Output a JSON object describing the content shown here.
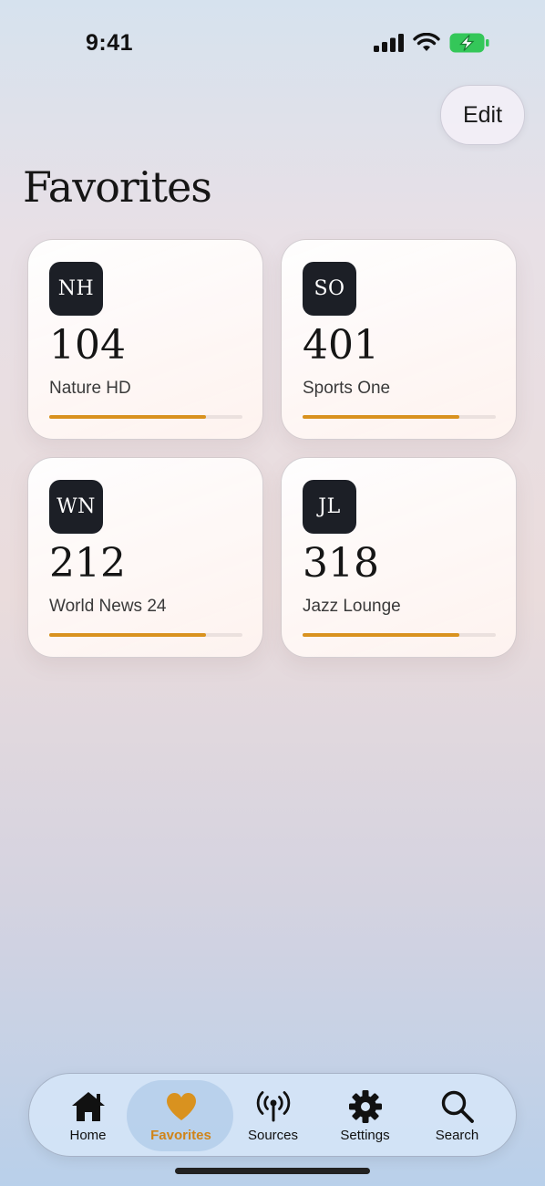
{
  "status_bar": {
    "time": "9:41"
  },
  "header": {
    "edit_label": "Edit",
    "title": "Favorites"
  },
  "favorites": [
    {
      "badge": "NH",
      "number": "104",
      "name": "Nature HD",
      "progress": 0.81
    },
    {
      "badge": "SO",
      "number": "401",
      "name": "Sports One",
      "progress": 0.81
    },
    {
      "badge": "WN",
      "number": "212",
      "name": "World News 24",
      "progress": 0.81
    },
    {
      "badge": "JL",
      "number": "318",
      "name": "Jazz Lounge",
      "progress": 0.81
    }
  ],
  "tab_bar": {
    "tabs": [
      {
        "label": "Home",
        "icon": "house-icon",
        "active": false
      },
      {
        "label": "Favorites",
        "icon": "heart-icon",
        "active": true
      },
      {
        "label": "Sources",
        "icon": "antenna-icon",
        "active": false
      },
      {
        "label": "Settings",
        "icon": "gear-icon",
        "active": false
      },
      {
        "label": "Search",
        "icon": "search-icon",
        "active": false
      }
    ]
  },
  "colors": {
    "accent": "#d9921f",
    "badge_bg": "#1c1f26",
    "battery": "#34c759"
  }
}
